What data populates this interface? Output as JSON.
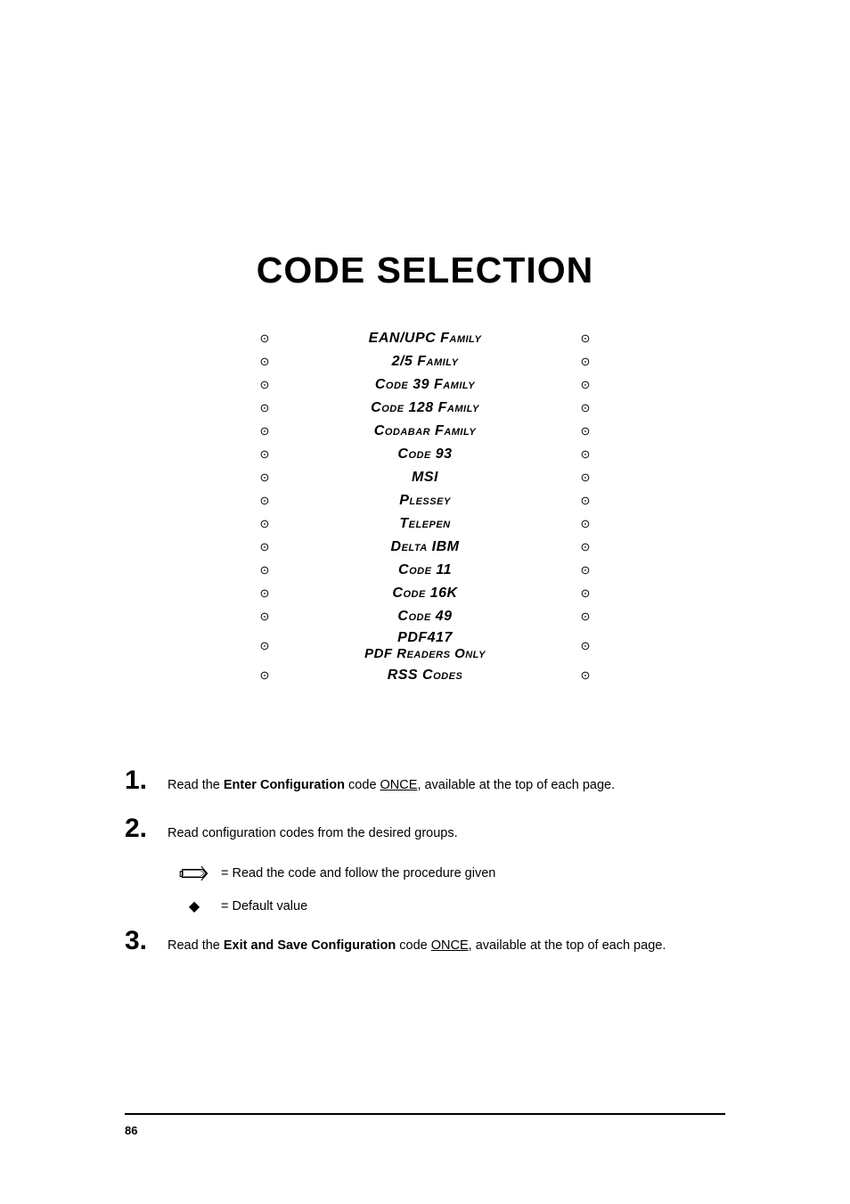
{
  "title": "CODE SELECTION",
  "bulletChar": "⊙",
  "toc": [
    {
      "label": "EAN/UPC Family"
    },
    {
      "label": "2/5 Family"
    },
    {
      "label": "Code 39 Family"
    },
    {
      "label": "Code 128 Family"
    },
    {
      "label": "Codabar Family"
    },
    {
      "label": "Code 93"
    },
    {
      "label": "MSI"
    },
    {
      "label": "Plessey"
    },
    {
      "label": "Telepen"
    },
    {
      "label": "Delta IBM"
    },
    {
      "label": "Code 11"
    },
    {
      "label": "Code 16K"
    },
    {
      "label": "Code 49"
    },
    {
      "label": "PDF417",
      "sub": "PDF Readers Only"
    },
    {
      "label": "RSS Codes"
    }
  ],
  "steps": {
    "s1": {
      "num": "1.",
      "pre": "Read the ",
      "bold": "Enter Configuration",
      "mid": " code ",
      "ul": "ONCE",
      "post": ", available at the top of each page."
    },
    "s2": {
      "num": "2.",
      "text": "Read configuration codes from the desired groups."
    },
    "legendHand": "= Read the code and follow the procedure given",
    "legendDiamond": "= Default value",
    "diamondChar": "◆",
    "s3": {
      "num": "3.",
      "pre": "Read the ",
      "bold": "Exit and Save Configuration",
      "mid": " code ",
      "ul": "ONCE",
      "post": ", available at the top of each page."
    }
  },
  "pageNumber": "86"
}
